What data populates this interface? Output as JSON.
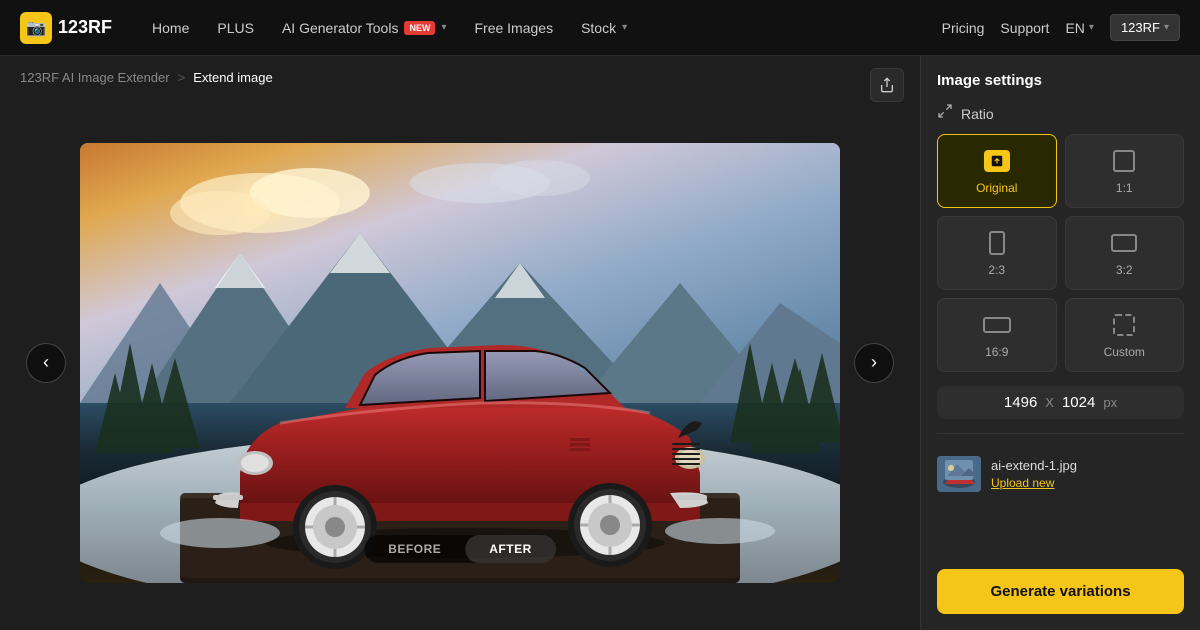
{
  "navbar": {
    "logo_text": "123RF",
    "logo_icon": "📷",
    "nav_items": [
      {
        "label": "Home",
        "has_dropdown": false,
        "has_badge": false
      },
      {
        "label": "PLUS",
        "has_dropdown": false,
        "has_badge": false
      },
      {
        "label": "AI Generator Tools",
        "has_dropdown": true,
        "has_badge": true,
        "badge_text": "NEW"
      },
      {
        "label": "Free Images",
        "has_dropdown": false,
        "has_badge": false
      },
      {
        "label": "Stock",
        "has_dropdown": true,
        "has_badge": false
      }
    ],
    "nav_right": [
      {
        "label": "Pricing"
      },
      {
        "label": "Support"
      },
      {
        "label": "EN",
        "has_dropdown": true
      }
    ],
    "user_label": "123RF"
  },
  "breadcrumb": {
    "parent_label": "123RF AI Image Extender",
    "separator": ">",
    "current_label": "Extend image"
  },
  "share_icon": "⬆",
  "nav_arrow_left": "‹",
  "nav_arrow_right": "›",
  "before_after": {
    "before_label": "BEFORE",
    "after_label": "AFTER",
    "active": "after"
  },
  "settings": {
    "title": "Image settings",
    "ratio_section_label": "Ratio",
    "ratio_icon": "⛶",
    "ratio_options": [
      {
        "id": "original",
        "label": "Original",
        "active": true
      },
      {
        "id": "1_1",
        "label": "1:1",
        "active": false
      },
      {
        "id": "2_3",
        "label": "2:3",
        "active": false
      },
      {
        "id": "3_2",
        "label": "3:2",
        "active": false
      },
      {
        "id": "16_9",
        "label": "16:9",
        "active": false
      },
      {
        "id": "custom",
        "label": "Custom",
        "active": false
      }
    ],
    "dimensions": {
      "width": "1496",
      "separator": "X",
      "height": "1024",
      "unit": "px"
    },
    "file": {
      "name": "ai-extend-1.jpg",
      "upload_new_label": "Upload new"
    },
    "generate_label": "Generate variations"
  }
}
